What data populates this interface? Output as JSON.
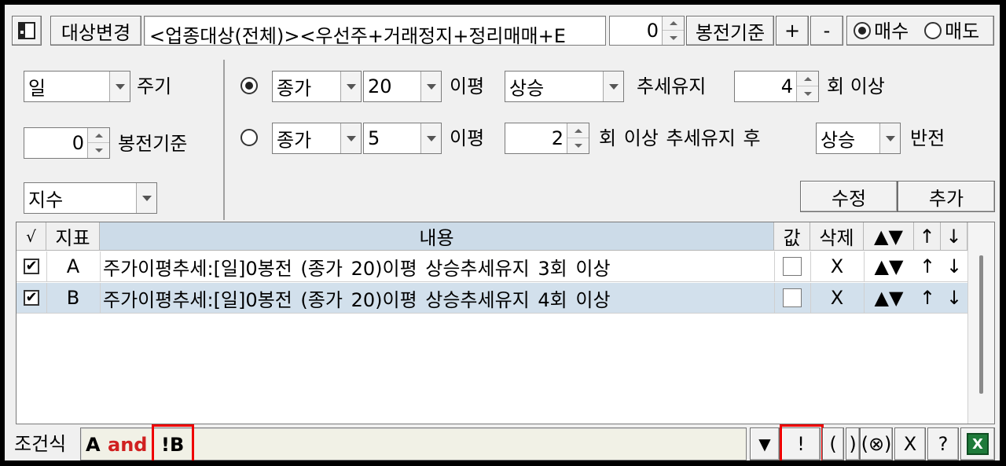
{
  "toolbar": {
    "target_change_label": "대상변경",
    "target_text": "<업종대상(전체)><우선주+거래정지+정리매매+E",
    "offset_value": "0",
    "offset_label": "봉전기준",
    "plus_label": "+",
    "minus_label": "-",
    "buy_label": "매수",
    "sell_label": "매도"
  },
  "left_panel": {
    "period_value": "일",
    "period_label": "주기",
    "offset_value": "0",
    "offset_label": "봉전기준",
    "index_value": "지수"
  },
  "condition1": {
    "price_type": "종가",
    "ma_period": "20",
    "ma_label": "이평",
    "direction": "상승",
    "trend_label": "추세유지",
    "count_value": "4",
    "count_suffix": "회 이상"
  },
  "condition2": {
    "price_type": "종가",
    "ma_period": "5",
    "ma_label": "이평",
    "count_value": "2",
    "middle_text": "회 이상 추세유지 후",
    "direction": "상승",
    "end_label": "반전"
  },
  "actions": {
    "modify_label": "수정",
    "add_label": "추가"
  },
  "grid": {
    "headers": {
      "check": "√",
      "indicator": "지표",
      "content": "내용",
      "value": "값",
      "delete": "삭제",
      "up_down": "▲▼",
      "up": "↑",
      "down": "↓"
    },
    "rows": [
      {
        "checked": "✔",
        "indicator": "A",
        "content": "주가이평추세:[일]0봉전 (종가 20)이평 상승추세유지 3회 이상",
        "delete": "X",
        "up_down": "▲▼",
        "up": "↑",
        "down": "↓"
      },
      {
        "checked": "✔",
        "indicator": "B",
        "content": "주가이평추세:[일]0봉전 (종가 20)이평 상승추세유지 4회 이상",
        "delete": "X",
        "up_down": "▲▼",
        "up": "↑",
        "down": "↓"
      }
    ]
  },
  "formula": {
    "label": "조건식",
    "token_a": "A",
    "token_and": "and",
    "token_b": "!B",
    "dropdown": "▼",
    "not_button": "!",
    "paren_open": "(",
    "paren_close": ")",
    "clear_button": "(⊗)",
    "x_button": "X",
    "help_button": "?",
    "excel_icon": "X"
  },
  "colors": {
    "highlight_red": "#e00000",
    "selected_row": "#d2e0ec",
    "excel_green": "#1e7a3a"
  }
}
